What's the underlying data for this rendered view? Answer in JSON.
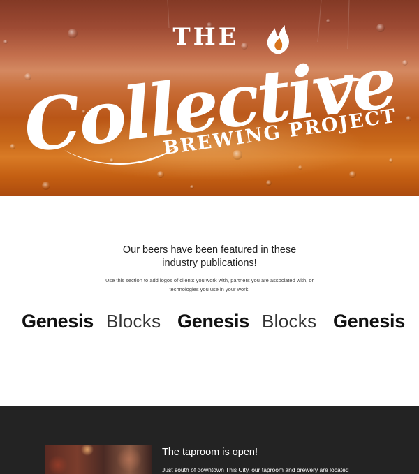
{
  "hero": {
    "logo": {
      "the": "THE",
      "collective": "Collective",
      "brewing_project": "BREWING PROJECT"
    }
  },
  "featured": {
    "headline": "Our beers have been featured in these industry publications!",
    "subtext": "Use this section to add logos of clients you work with, partners you are associated with, or technologies you use in your work!",
    "logos": [
      {
        "text": "Genesis",
        "style": "bold"
      },
      {
        "text": "Blocks",
        "style": "light"
      },
      {
        "text": "Genesis",
        "style": "bold"
      },
      {
        "text": "Blocks",
        "style": "light"
      },
      {
        "text": "Genesis",
        "style": "bold"
      }
    ]
  },
  "taproom": {
    "title": "The taproom is open!",
    "body": "Just south of downtown This City, our taproom and brewery are located"
  },
  "colors": {
    "hero_orange": "#d8741c",
    "dark_section": "#232323",
    "text_dark": "#222222",
    "text_light": "#ffffff"
  }
}
